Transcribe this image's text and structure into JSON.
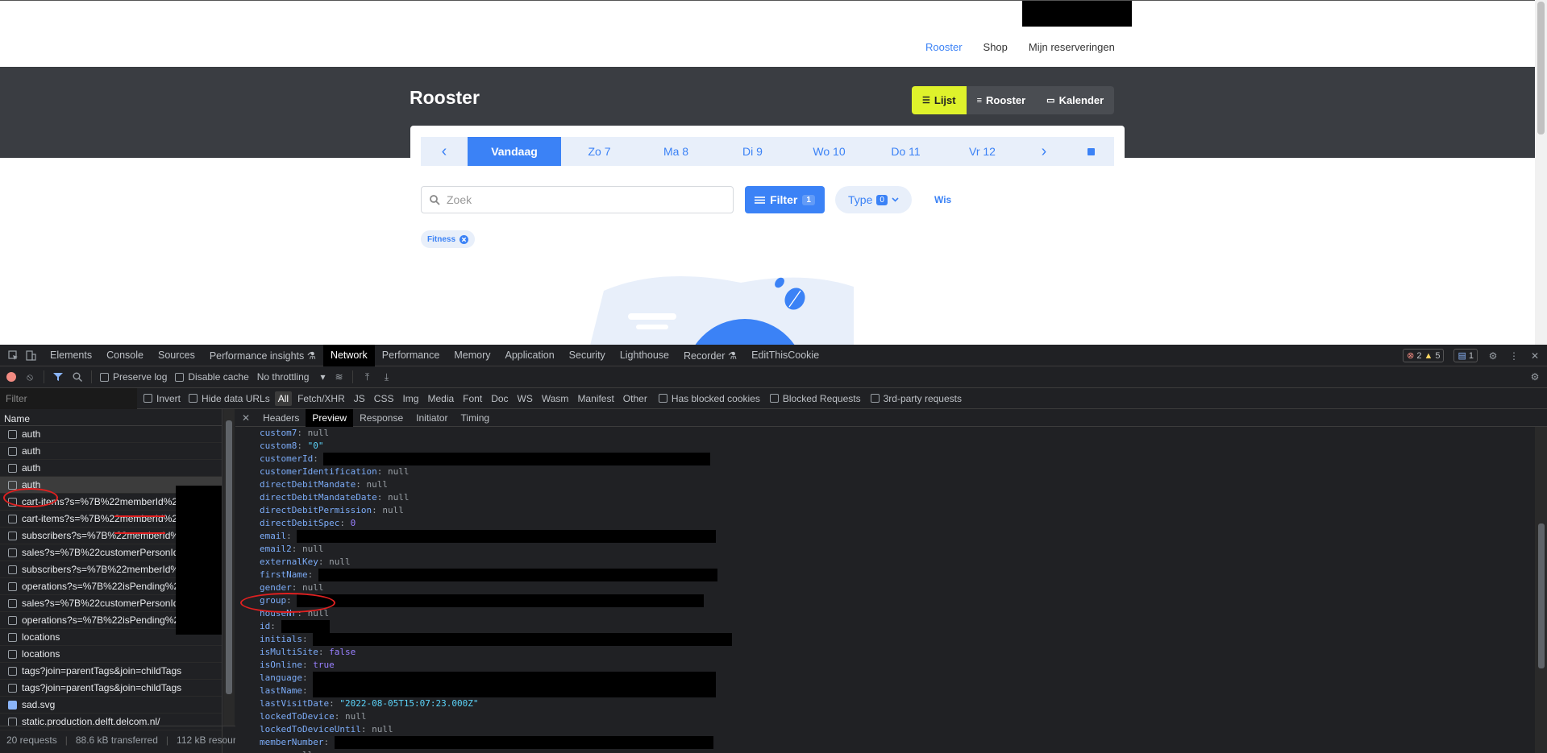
{
  "site": {
    "nav": [
      "Rooster",
      "Shop",
      "Mijn reserveringen"
    ],
    "nav_active": "Rooster",
    "title": "Rooster",
    "views": [
      {
        "label": "Lijst",
        "icon": "list-icon"
      },
      {
        "label": "Rooster",
        "icon": "lines-icon"
      },
      {
        "label": "Kalender",
        "icon": "calendar-icon"
      }
    ],
    "days": [
      "Vandaag",
      "Zo 7",
      "Ma 8",
      "Di 9",
      "Wo 10",
      "Do 11",
      "Vr 12"
    ],
    "search_placeholder": "Zoek",
    "filter_label": "Filter",
    "filter_count": "1",
    "type_label": "Type",
    "type_count": "0",
    "clear_label": "Wis",
    "chip_label": "Fitness",
    "accent": "#3b82f6",
    "highlight": "#dff22b"
  },
  "devtools": {
    "tabs": [
      "Elements",
      "Console",
      "Sources",
      "Performance insights ⚗",
      "Network",
      "Performance",
      "Memory",
      "Application",
      "Security",
      "Lighthouse",
      "Recorder ⚗",
      "EditThisCookie"
    ],
    "active_tab": "Network",
    "errors": "2",
    "warnings": "5",
    "messages": "1",
    "toolbar": {
      "preserve_log": "Preserve log",
      "disable_cache": "Disable cache",
      "throttling": "No throttling"
    },
    "filter": {
      "placeholder": "Filter",
      "invert": "Invert",
      "hide_data_urls": "Hide data URLs",
      "types": [
        "All",
        "Fetch/XHR",
        "JS",
        "CSS",
        "Img",
        "Media",
        "Font",
        "Doc",
        "WS",
        "Wasm",
        "Manifest",
        "Other"
      ],
      "has_blocked_cookies": "Has blocked cookies",
      "blocked_requests": "Blocked Requests",
      "third_party": "3rd-party requests"
    },
    "name_header": "Name",
    "requests": [
      "auth",
      "auth",
      "auth",
      "auth",
      "cart-items?s=%7B%22memberId%22",
      "cart-items?s=%7B%22memberId%22",
      "subscribers?s=%7B%22memberId%22",
      "sales?s=%7B%22customerPersonId%",
      "subscribers?s=%7B%22memberId%22",
      "operations?s=%7B%22isPending%22",
      "sales?s=%7B%22customerPersonId%",
      "operations?s=%7B%22isPending%22",
      "locations",
      "locations",
      "tags?join=parentTags&join=childTags",
      "tags?join=parentTags&join=childTags",
      "sad.svg",
      "static.production.delft.delcom.nl/"
    ],
    "status": {
      "requests": "20 requests",
      "transferred": "88.6 kB transferred",
      "resources": "112 kB resources"
    },
    "detail_tabs": [
      "Headers",
      "Preview",
      "Response",
      "Initiator",
      "Timing"
    ],
    "active_detail_tab": "Preview",
    "preview_lines": [
      {
        "key": "custom7",
        "val": "null",
        "t": "n"
      },
      {
        "key": "custom8",
        "val": "\"0\"",
        "t": "s"
      },
      {
        "key": "customerId",
        "val": "",
        "t": "r"
      },
      {
        "key": "customerIdentification",
        "val": "null",
        "t": "n"
      },
      {
        "key": "directDebitMandate",
        "val": "null",
        "t": "n"
      },
      {
        "key": "directDebitMandateDate",
        "val": "null",
        "t": "n"
      },
      {
        "key": "directDebitPermission",
        "val": "null",
        "t": "n"
      },
      {
        "key": "directDebitSpec",
        "val": "0",
        "t": "num"
      },
      {
        "key": "email",
        "val": "",
        "t": "r"
      },
      {
        "key": "email2",
        "val": "null",
        "t": "n"
      },
      {
        "key": "externalKey",
        "val": "null",
        "t": "n"
      },
      {
        "key": "firstName",
        "val": "",
        "t": "r"
      },
      {
        "key": "gender",
        "val": "null",
        "t": "n"
      },
      {
        "key": "group",
        "val": "",
        "t": "r"
      },
      {
        "key": "houseNr",
        "val": "null",
        "t": "n"
      },
      {
        "key": "id",
        "val": "",
        "t": "r"
      },
      {
        "key": "initials",
        "val": "",
        "t": "r"
      },
      {
        "key": "isMultiSite",
        "val": "false",
        "t": "b"
      },
      {
        "key": "isOnline",
        "val": "true",
        "t": "b"
      },
      {
        "key": "language",
        "val": "",
        "t": "r"
      },
      {
        "key": "lastName",
        "val": "",
        "t": "r"
      },
      {
        "key": "lastVisitDate",
        "val": "\"2022-08-05T15:07:23.000Z\"",
        "t": "s"
      },
      {
        "key": "lockedToDevice",
        "val": "null",
        "t": "n"
      },
      {
        "key": "lockedToDeviceUntil",
        "val": "null",
        "t": "n"
      },
      {
        "key": "memberNumber",
        "val": "",
        "t": "r"
      },
      {
        "key": "memo",
        "val": "null",
        "t": "n"
      }
    ]
  }
}
